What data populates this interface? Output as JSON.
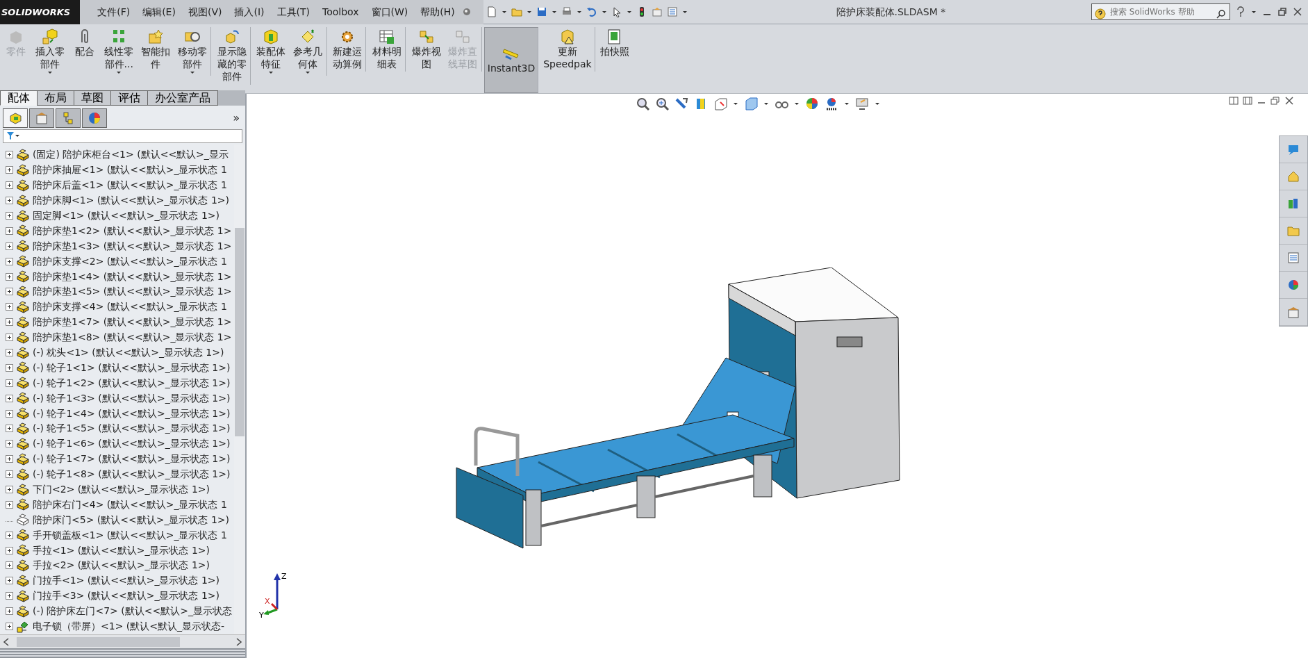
{
  "logo": "SOLIDWORKS",
  "menu": [
    "文件(F)",
    "编辑(E)",
    "视图(V)",
    "插入(I)",
    "工具(T)",
    "Toolbox",
    "窗口(W)",
    "帮助(H)"
  ],
  "title": "陪护床装配体.SLDASM *",
  "search": {
    "placeholder": "搜索 SolidWorks 帮助"
  },
  "ribbon": [
    {
      "label": "零件",
      "caret": false,
      "disabled": true,
      "selected": false,
      "divider_after": false
    },
    {
      "label": "插入零部件",
      "caret": true,
      "disabled": false,
      "selected": false,
      "divider_after": false
    },
    {
      "label": "配合",
      "caret": false,
      "disabled": false,
      "selected": false,
      "divider_after": false
    },
    {
      "label": "线性零部件...",
      "caret": true,
      "disabled": false,
      "selected": false,
      "divider_after": false
    },
    {
      "label": "智能扣件",
      "caret": false,
      "disabled": false,
      "selected": false,
      "divider_after": false
    },
    {
      "label": "移动零部件",
      "caret": true,
      "disabled": false,
      "selected": false,
      "divider_after": true
    },
    {
      "label": "显示隐藏的零部件",
      "caret": false,
      "disabled": false,
      "selected": false,
      "divider_after": true
    },
    {
      "label": "装配体特征",
      "caret": true,
      "disabled": false,
      "selected": false,
      "divider_after": false
    },
    {
      "label": "参考几何体",
      "caret": true,
      "disabled": false,
      "selected": false,
      "divider_after": true
    },
    {
      "label": "新建运动算例",
      "caret": false,
      "disabled": false,
      "selected": false,
      "divider_after": true
    },
    {
      "label": "材料明细表",
      "caret": false,
      "disabled": false,
      "selected": false,
      "divider_after": true
    },
    {
      "label": "爆炸视图",
      "caret": false,
      "disabled": false,
      "selected": false,
      "divider_after": false
    },
    {
      "label": "爆炸直线草图",
      "caret": false,
      "disabled": true,
      "selected": false,
      "divider_after": true
    },
    {
      "label": "Instant3D",
      "caret": false,
      "disabled": false,
      "selected": true,
      "divider_after": true
    },
    {
      "label": "更新Speedpak",
      "caret": false,
      "disabled": false,
      "selected": false,
      "divider_after": true
    },
    {
      "label": "拍快照",
      "caret": false,
      "disabled": false,
      "selected": false,
      "divider_after": false
    }
  ],
  "tabs": [
    {
      "label": "配体",
      "selected": true
    },
    {
      "label": "布局",
      "selected": false
    },
    {
      "label": "草图",
      "selected": false
    },
    {
      "label": "评估",
      "selected": false
    },
    {
      "label": "办公室产品",
      "selected": false
    }
  ],
  "panel_tabs": [
    {
      "selected": true
    },
    {
      "selected": false
    },
    {
      "selected": false
    },
    {
      "selected": false
    }
  ],
  "panel_more": "»",
  "tree": [
    {
      "text": "(固定) 陪护床柜台<1> (默认<<默认>_显示",
      "kind": "part",
      "expandable": true
    },
    {
      "text": "陪护床抽屉<1> (默认<<默认>_显示状态 1",
      "kind": "part",
      "expandable": true
    },
    {
      "text": "陪护床后盖<1> (默认<<默认>_显示状态 1",
      "kind": "part",
      "expandable": true
    },
    {
      "text": "陪护床脚<1> (默认<<默认>_显示状态 1>)",
      "kind": "part",
      "expandable": true
    },
    {
      "text": "固定脚<1> (默认<<默认>_显示状态 1>)",
      "kind": "part",
      "expandable": true
    },
    {
      "text": "陪护床垫1<2> (默认<<默认>_显示状态 1>",
      "kind": "part",
      "expandable": true
    },
    {
      "text": "陪护床垫1<3> (默认<<默认>_显示状态 1>",
      "kind": "part",
      "expandable": true
    },
    {
      "text": "陪护床支撑<2> (默认<<默认>_显示状态 1",
      "kind": "part",
      "expandable": true
    },
    {
      "text": "陪护床垫1<4> (默认<<默认>_显示状态 1>",
      "kind": "part",
      "expandable": true
    },
    {
      "text": "陪护床垫1<5> (默认<<默认>_显示状态 1>",
      "kind": "part",
      "expandable": true
    },
    {
      "text": "陪护床支撑<4> (默认<<默认>_显示状态 1",
      "kind": "part",
      "expandable": true
    },
    {
      "text": "陪护床垫1<7> (默认<<默认>_显示状态 1>",
      "kind": "part",
      "expandable": true
    },
    {
      "text": "陪护床垫1<8> (默认<<默认>_显示状态 1>",
      "kind": "part",
      "expandable": true
    },
    {
      "text": "(-) 枕头<1> (默认<<默认>_显示状态 1>)",
      "kind": "part",
      "expandable": true
    },
    {
      "text": "(-) 轮子1<1> (默认<<默认>_显示状态 1>)",
      "kind": "part",
      "expandable": true
    },
    {
      "text": "(-) 轮子1<2> (默认<<默认>_显示状态 1>)",
      "kind": "part",
      "expandable": true
    },
    {
      "text": "(-) 轮子1<3> (默认<<默认>_显示状态 1>)",
      "kind": "part",
      "expandable": true
    },
    {
      "text": "(-) 轮子1<4> (默认<<默认>_显示状态 1>)",
      "kind": "part",
      "expandable": true
    },
    {
      "text": "(-) 轮子1<5> (默认<<默认>_显示状态 1>)",
      "kind": "part",
      "expandable": true
    },
    {
      "text": "(-) 轮子1<6> (默认<<默认>_显示状态 1>)",
      "kind": "part",
      "expandable": true
    },
    {
      "text": "(-) 轮子1<7> (默认<<默认>_显示状态 1>)",
      "kind": "part",
      "expandable": true
    },
    {
      "text": "(-) 轮子1<8> (默认<<默认>_显示状态 1>)",
      "kind": "part",
      "expandable": true
    },
    {
      "text": "下门<2> (默认<<默认>_显示状态 1>)",
      "kind": "part",
      "expandable": true
    },
    {
      "text": "陪护床右门<4> (默认<<默认>_显示状态 1",
      "kind": "part",
      "expandable": true
    },
    {
      "text": "陪护床门<5> (默认<<默认>_显示状态 1>)",
      "kind": "hidden",
      "expandable": false
    },
    {
      "text": "手开锁盖板<1> (默认<<默认>_显示状态 1",
      "kind": "part",
      "expandable": true
    },
    {
      "text": "手拉<1> (默认<<默认>_显示状态 1>)",
      "kind": "part",
      "expandable": true
    },
    {
      "text": "手拉<2> (默认<<默认>_显示状态 1>)",
      "kind": "part",
      "expandable": true
    },
    {
      "text": "门拉手<1> (默认<<默认>_显示状态 1>)",
      "kind": "part",
      "expandable": true
    },
    {
      "text": "门拉手<3> (默认<<默认>_显示状态 1>)",
      "kind": "part",
      "expandable": true
    },
    {
      "text": "(-) 陪护床左门<7> (默认<<默认>_显示状态",
      "kind": "part",
      "expandable": true
    },
    {
      "text": "电子锁（带屏）<1> (默认<默认_显示状态-",
      "kind": "subassembly",
      "expandable": true
    }
  ],
  "triad": {
    "z": "Z",
    "x": "X",
    "y": "Y"
  }
}
